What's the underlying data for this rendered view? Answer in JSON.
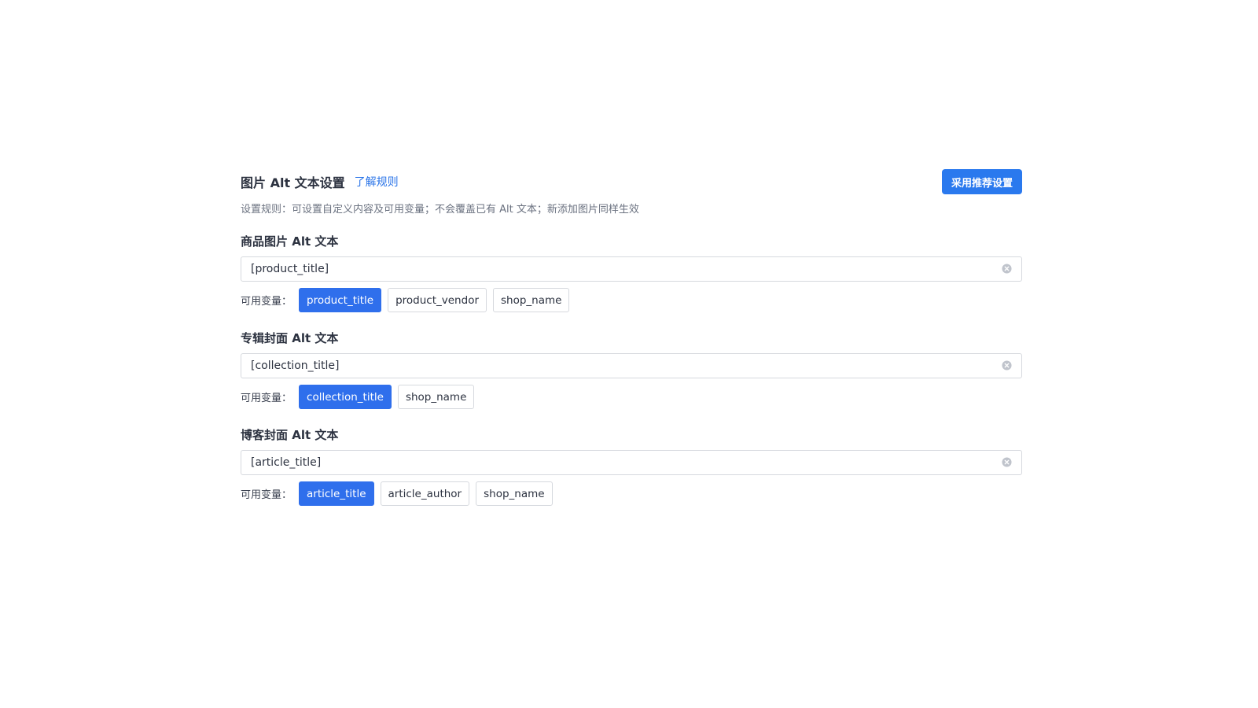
{
  "header": {
    "title": "图片 Alt 文本设置",
    "rules_link": "了解规则",
    "apply_button": "采用推荐设置"
  },
  "description": "设置规则：可设置自定义内容及可用变量；不会覆盖已有 Alt 文本；新添加图片同样生效",
  "vars_label": "可用变量：",
  "sections": [
    {
      "title": "商品图片 Alt 文本",
      "input_value": "[product_title]",
      "variables": [
        "product_title",
        "product_vendor",
        "shop_name"
      ],
      "active_variable": "product_title"
    },
    {
      "title": "专辑封面 Alt 文本",
      "input_value": "[collection_title]",
      "variables": [
        "collection_title",
        "shop_name"
      ],
      "active_variable": "collection_title"
    },
    {
      "title": "博客封面 Alt 文本",
      "input_value": "[article_title]",
      "variables": [
        "article_title",
        "article_author",
        "shop_name"
      ],
      "active_variable": "article_title"
    }
  ],
  "colors": {
    "primary": "#2a79ee",
    "chip_active": "#2f6fec",
    "link": "#2a74e8"
  },
  "icons": {
    "clear": "close-circle-icon"
  }
}
